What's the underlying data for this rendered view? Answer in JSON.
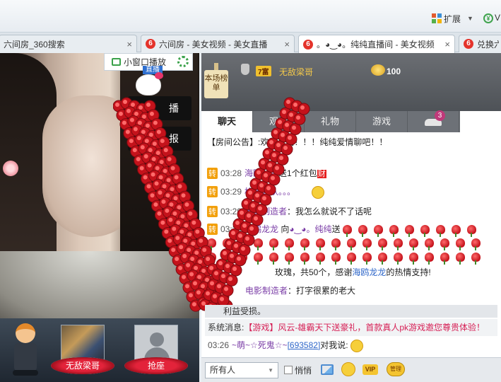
{
  "browser": {
    "extensions_label": "扩展",
    "shield_label": "V"
  },
  "tabs": [
    {
      "label": "六间房_360搜索"
    },
    {
      "label": "六间房 - 美女视频 - 美女直播"
    },
    {
      "label": "。◕‿◕。纯纯直播间 - 美女视频"
    },
    {
      "label": "兑换六"
    }
  ],
  "video": {
    "mini_window_label": "小窗口播放",
    "live_tag": "直播",
    "broadcast_button": "播",
    "report_button": "报"
  },
  "seats": [
    {
      "label": "无敌梁哥"
    },
    {
      "label": "抢座"
    }
  ],
  "rank": {
    "board_label": "本场榜单",
    "level": "7富",
    "user": "无敌梁哥",
    "score": "100"
  },
  "chat_tabs": [
    {
      "label": "聊天"
    },
    {
      "label": "观众"
    },
    {
      "label": "礼物"
    },
    {
      "label": "游戏"
    }
  ],
  "car_badge": "3",
  "messages": {
    "announcement": "【房间公告】:欢迎来到！！！纯纯爱情聊吧！！",
    "m1_tag": "转",
    "m1_time": "03:28",
    "m1_user": "海鸥龙龙",
    "m1_text": "送1个红包",
    "m1_badge": "财",
    "m2_tag": "转",
    "m2_time": "03:29",
    "m2_user": "格敢死队。。。",
    "m3_tag": "转",
    "m3_time": "03:29",
    "m3_user": "电影制造者",
    "m3_text": "：我怎么就说不了话呢",
    "m4_tag": "转",
    "m4_time": "03:29",
    "m4_user": "海鸥龙龙",
    "m4_text1": "向",
    "m4_target": "◕‿◕。纯纯",
    "m4_text2": "送",
    "m5_text": "玫瑰，共50个，感谢",
    "m5_user": "海鸥龙龙",
    "m5_text2": "的热情支持!",
    "m6_user": "电影制造者",
    "m6_text": "：打字很累的老大"
  },
  "benefit_text": "利益受损。",
  "system": {
    "label": "系统消息:",
    "message": "【游戏】风云-雄霸天下送豪礼，首款真人pk游戏邀您尊贵体验！"
  },
  "last_message": {
    "time": "03:26",
    "user": "~萌~☆死鬼☆~",
    "id": "[693582]",
    "text": "对我说:"
  },
  "input_bar": {
    "recipient": "所有人",
    "whisper_label": "悄悄",
    "vip_label": "VIP",
    "emote_label": "管理"
  },
  "colors": {
    "accent_green": "#3aa14a",
    "rose_red": "#c4121b",
    "tab_logo_red": "#e4332b",
    "link_blue": "#2f67c9",
    "user_purple": "#7a3ca6",
    "system_pink": "#d61f55"
  }
}
